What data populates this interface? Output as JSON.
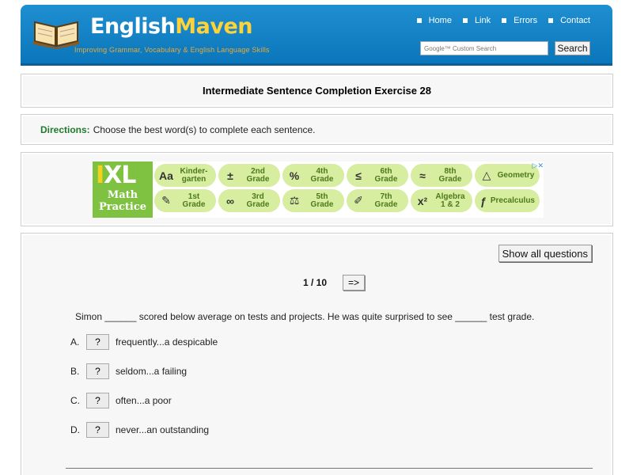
{
  "header": {
    "logo_word1": "English",
    "logo_word2": "Maven",
    "tagline": "Improving Grammar, Vocabulary & English Language Skills",
    "nav": [
      "Home",
      "Link",
      "Errors",
      "Contact"
    ],
    "search_placeholder": "Google™ Custom Search",
    "search_button": "Search",
    "colors": {
      "header_bg": "#1a86c8",
      "logo_accent": "#ffd23a"
    }
  },
  "page_title": "Intermediate Sentence Completion Exercise 28",
  "directions": {
    "label": "Directions:",
    "text": "Choose the best word(s) to complete each sentence."
  },
  "ad": {
    "brand_ixl_i": "I",
    "brand_ixl_xl": "XL",
    "brand_line1": "Math",
    "brand_line2": "Practice",
    "close_glyph": "▷✕",
    "tiles_row1": [
      {
        "icon": "Aa",
        "label": "Kinder-\ngarten"
      },
      {
        "icon": "±",
        "label": "2nd\nGrade"
      },
      {
        "icon": "%",
        "label": "4th\nGrade"
      },
      {
        "icon": "≤",
        "label": "6th\nGrade"
      },
      {
        "icon": "≈",
        "label": "8th\nGrade"
      },
      {
        "icon": "△",
        "label": "Geometry"
      }
    ],
    "tiles_row2": [
      {
        "icon": "✎",
        "label": "1st\nGrade"
      },
      {
        "icon": "∞",
        "label": "3rd\nGrade"
      },
      {
        "icon": "⚖",
        "label": "5th\nGrade"
      },
      {
        "icon": "✐",
        "label": "7th\nGrade"
      },
      {
        "icon": "x²",
        "label": "Algebra\n1 & 2"
      },
      {
        "icon": "ƒ",
        "label": "Precalculus"
      }
    ]
  },
  "quiz": {
    "show_all_label": "Show all questions",
    "current_label": "1 / 10",
    "next_label": "=>",
    "question": "Simon ______ scored below average on tests and projects. He was quite surprised to see ______ test grade.",
    "reveal_label": "?",
    "answers": [
      {
        "letter": "A.",
        "text": "frequently...a despicable"
      },
      {
        "letter": "B.",
        "text": "seldom...a failing"
      },
      {
        "letter": "C.",
        "text": "often...a poor"
      },
      {
        "letter": "D.",
        "text": "never...an outstanding"
      }
    ]
  }
}
